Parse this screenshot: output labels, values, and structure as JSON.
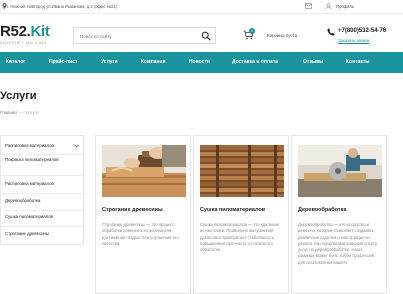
{
  "topbar": {
    "address": "г. Нижний Новгород ул.Ивана Романова, д.2 (офис №21)",
    "profile_label": "Профиль"
  },
  "header": {
    "logo_main": "R52.",
    "logo_accent": "Kit",
    "logo_sub": "ИНТЕРНЕТ МАГАЗИН",
    "search_placeholder": "Поиск по сайту",
    "cart_count": "0",
    "cart_label": "Корзина пуста",
    "phone": "+7(800)532-54-76",
    "callback": "Заказать звонок"
  },
  "nav": {
    "items": [
      "Каталог",
      "Прайс-лист",
      "Услуги",
      "Компания",
      "Новости",
      "Доставка и оплата",
      "Отзывы",
      "Контакты"
    ]
  },
  "page": {
    "title": "Услуги",
    "breadcrumb_home": "Главная",
    "breadcrumb_sep": "—",
    "breadcrumb_current": "Услуги"
  },
  "sidebar": {
    "items": [
      "Распиловка материалов",
      "Покраска пиломатериалов",
      "Распиловка материалов",
      "Деревообработка",
      "Сушка пиломатериалов",
      "Строгание древесины"
    ]
  },
  "cards": [
    {
      "title": "Строгание древесины",
      "desc": "Строгание древесины — это процесс обработки поверхности дерева для достижения гладкости и улучшения его качества"
    },
    {
      "title": "Сушка пиломатериалов",
      "desc": "Сушка пиломатериалов — это удаление из них влаги. Правильно высушенная древесина приобретает стабильность, повышенную прочность и стойкость к обработке"
    },
    {
      "title": "Деревообработка",
      "desc": "Деревообработка — это искусство и ремесло, которое позволяет создавать различные изделия и конструкции из дерева. Мы предлагаем широкий спектр услуг по деревообработке. Наша команда может быть хобби профессий для изготовления вашего"
    }
  ],
  "colors": {
    "accent": "#19939e"
  }
}
